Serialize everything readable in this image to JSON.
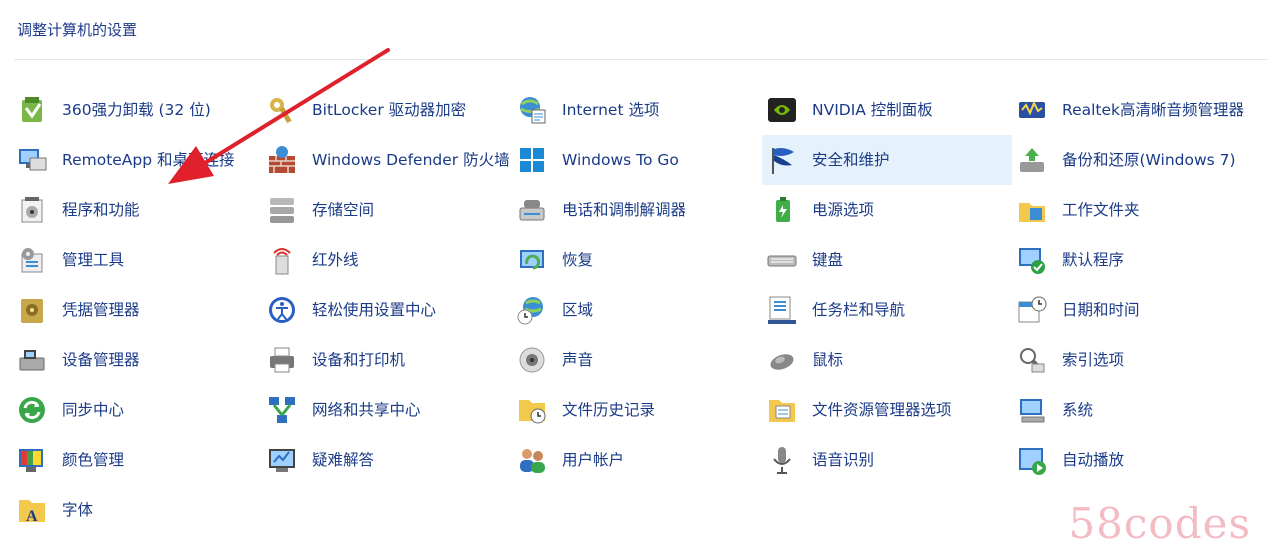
{
  "header": {
    "title": "调整计算机的设置"
  },
  "items": [
    {
      "label": "360强力卸载 (32 位)",
      "icon": "uninstaller-icon"
    },
    {
      "label": "BitLocker 驱动器加密",
      "icon": "bitlocker-key-icon"
    },
    {
      "label": "Internet 选项",
      "icon": "internet-options-icon"
    },
    {
      "label": "NVIDIA 控制面板",
      "icon": "nvidia-icon"
    },
    {
      "label": "Realtek高清晰音频管理器",
      "icon": "realtek-audio-icon"
    },
    {
      "label": "RemoteApp 和桌面连接",
      "icon": "remoteapp-icon"
    },
    {
      "label": "Windows Defender 防火墙",
      "icon": "firewall-icon"
    },
    {
      "label": "Windows To Go",
      "icon": "windows-to-go-icon"
    },
    {
      "label": "安全和维护",
      "icon": "security-flag-icon",
      "highlighted": true
    },
    {
      "label": "备份和还原(Windows 7)",
      "icon": "backup-restore-icon"
    },
    {
      "label": "程序和功能",
      "icon": "programs-features-icon"
    },
    {
      "label": "存储空间",
      "icon": "storage-spaces-icon"
    },
    {
      "label": "电话和调制解调器",
      "icon": "phone-modem-icon"
    },
    {
      "label": "电源选项",
      "icon": "power-options-icon"
    },
    {
      "label": "工作文件夹",
      "icon": "work-folders-icon"
    },
    {
      "label": "管理工具",
      "icon": "admin-tools-icon"
    },
    {
      "label": "红外线",
      "icon": "infrared-icon"
    },
    {
      "label": "恢复",
      "icon": "recovery-icon"
    },
    {
      "label": "键盘",
      "icon": "keyboard-icon"
    },
    {
      "label": "默认程序",
      "icon": "default-programs-icon"
    },
    {
      "label": "凭据管理器",
      "icon": "credential-manager-icon"
    },
    {
      "label": "轻松使用设置中心",
      "icon": "ease-of-access-icon"
    },
    {
      "label": "区域",
      "icon": "region-icon"
    },
    {
      "label": "任务栏和导航",
      "icon": "taskbar-icon"
    },
    {
      "label": "日期和时间",
      "icon": "date-time-icon"
    },
    {
      "label": "设备管理器",
      "icon": "device-manager-icon"
    },
    {
      "label": "设备和打印机",
      "icon": "printer-icon"
    },
    {
      "label": "声音",
      "icon": "sound-icon"
    },
    {
      "label": "鼠标",
      "icon": "mouse-icon"
    },
    {
      "label": "索引选项",
      "icon": "indexing-icon"
    },
    {
      "label": "同步中心",
      "icon": "sync-center-icon"
    },
    {
      "label": "网络和共享中心",
      "icon": "network-icon"
    },
    {
      "label": "文件历史记录",
      "icon": "file-history-icon"
    },
    {
      "label": "文件资源管理器选项",
      "icon": "explorer-options-icon"
    },
    {
      "label": "系统",
      "icon": "system-icon"
    },
    {
      "label": "颜色管理",
      "icon": "color-management-icon"
    },
    {
      "label": "疑难解答",
      "icon": "troubleshooting-icon"
    },
    {
      "label": "用户帐户",
      "icon": "user-accounts-icon"
    },
    {
      "label": "语音识别",
      "icon": "microphone-icon"
    },
    {
      "label": "自动播放",
      "icon": "autoplay-icon"
    },
    {
      "label": "字体",
      "icon": "fonts-icon"
    }
  ],
  "watermark": "58codes",
  "colors": {
    "label": "#1b3b88",
    "highlight": "#e6f2fb",
    "arrow": "#e0202a"
  }
}
